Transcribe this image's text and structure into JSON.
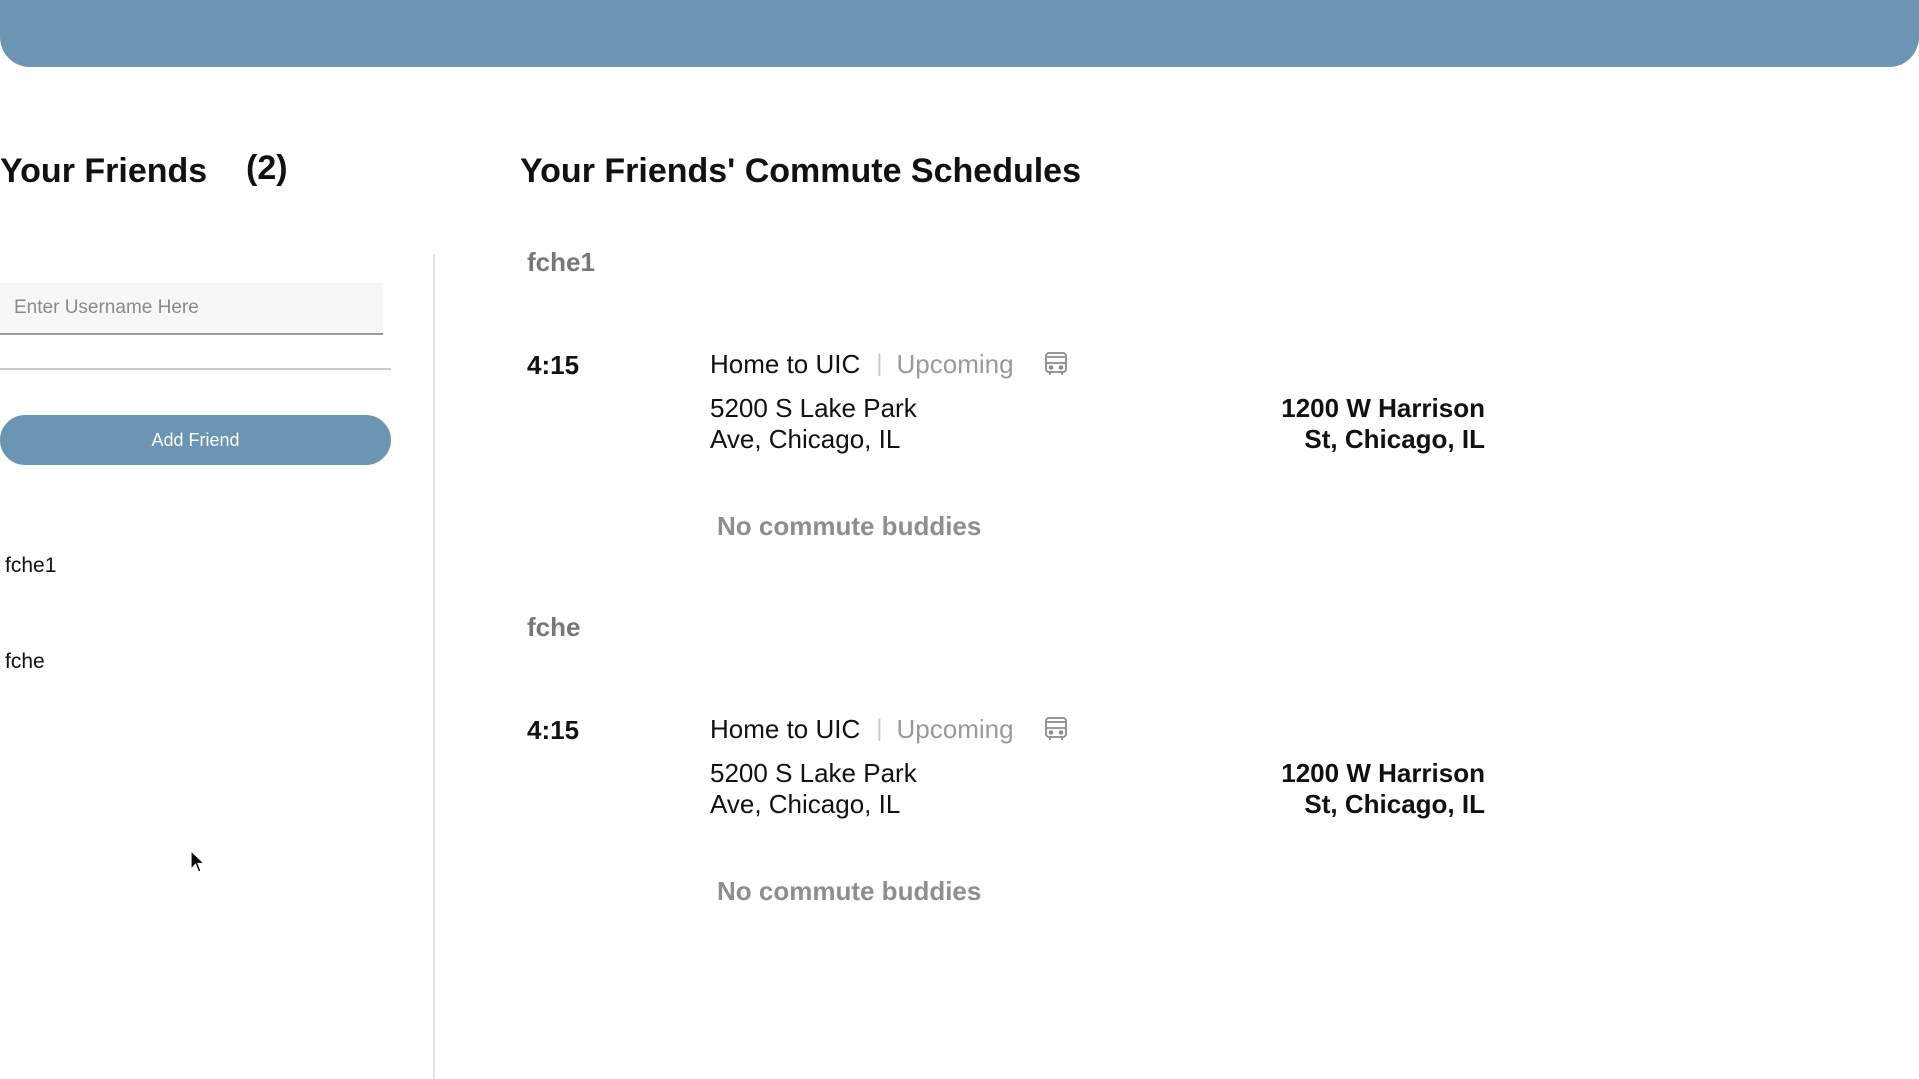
{
  "friends_panel": {
    "title": "Your Friends",
    "count": "(2)",
    "username_placeholder": "Enter Username Here",
    "add_button_label": "Add Friend",
    "friends": [
      "fche1",
      "fche"
    ]
  },
  "schedules_panel": {
    "title": "Your Friends' Commute Schedules",
    "entries": [
      {
        "username": "fche1",
        "time": "4:15",
        "route": "Home to UIC",
        "separator": "|",
        "status": "Upcoming",
        "mode_icon": "bus-icon",
        "from_line1": "5200 S Lake Park",
        "from_line2": "Ave, Chicago, IL",
        "to_line1": "1200 W Harrison",
        "to_line2": "St, Chicago, IL",
        "buddies": "No commute buddies"
      },
      {
        "username": "fche",
        "time": "4:15",
        "route": "Home to UIC",
        "separator": "|",
        "status": "Upcoming",
        "mode_icon": "bus-icon",
        "from_line1": "5200 S Lake Park",
        "from_line2": "Ave, Chicago, IL",
        "to_line1": "1200 W Harrison",
        "to_line2": "St, Chicago, IL",
        "buddies": "No commute buddies"
      }
    ]
  },
  "colors": {
    "accent": "#6c95b3",
    "muted_text": "#8e8e8e"
  }
}
